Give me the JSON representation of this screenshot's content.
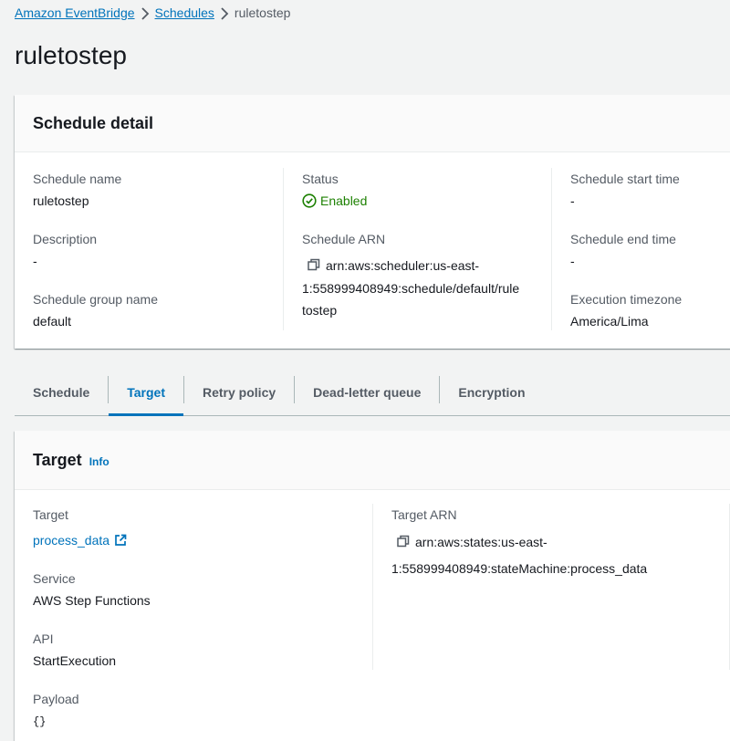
{
  "breadcrumb": {
    "items": [
      {
        "label": "Amazon EventBridge"
      },
      {
        "label": "Schedules"
      }
    ],
    "current": "ruletostep"
  },
  "page": {
    "title": "ruletostep"
  },
  "schedule_detail": {
    "heading": "Schedule detail",
    "fields": {
      "schedule_name": {
        "label": "Schedule name",
        "value": "ruletostep"
      },
      "description": {
        "label": "Description",
        "value": "-"
      },
      "group_name": {
        "label": "Schedule group name",
        "value": "default"
      },
      "status": {
        "label": "Status",
        "value": "Enabled"
      },
      "arn": {
        "label": "Schedule ARN",
        "line1": "arn:aws:scheduler:us-east-",
        "line2": "1:558999408949:schedule/default/rule",
        "line3": "tostep"
      },
      "start_time": {
        "label": "Schedule start time",
        "value": "-"
      },
      "end_time": {
        "label": "Schedule end time",
        "value": "-"
      },
      "timezone": {
        "label": "Execution timezone",
        "value": "America/Lima"
      }
    }
  },
  "tabs": [
    {
      "label": "Schedule"
    },
    {
      "label": "Target"
    },
    {
      "label": "Retry policy"
    },
    {
      "label": "Dead-letter queue"
    },
    {
      "label": "Encryption"
    }
  ],
  "active_tab": "Target",
  "target_panel": {
    "heading": "Target",
    "info": "Info",
    "fields": {
      "target": {
        "label": "Target",
        "value": "process_data"
      },
      "service": {
        "label": "Service",
        "value": "AWS Step Functions"
      },
      "api": {
        "label": "API",
        "value": "StartExecution"
      },
      "payload": {
        "label": "Payload",
        "value": "{}"
      },
      "target_arn": {
        "label": "Target ARN",
        "line1": "arn:aws:states:us-east-",
        "line2": "1:558999408949:stateMachine:process_data"
      }
    }
  },
  "colors": {
    "link": "#0073bb",
    "success": "#1d8102",
    "text": "#16191f",
    "muted": "#545b64"
  }
}
